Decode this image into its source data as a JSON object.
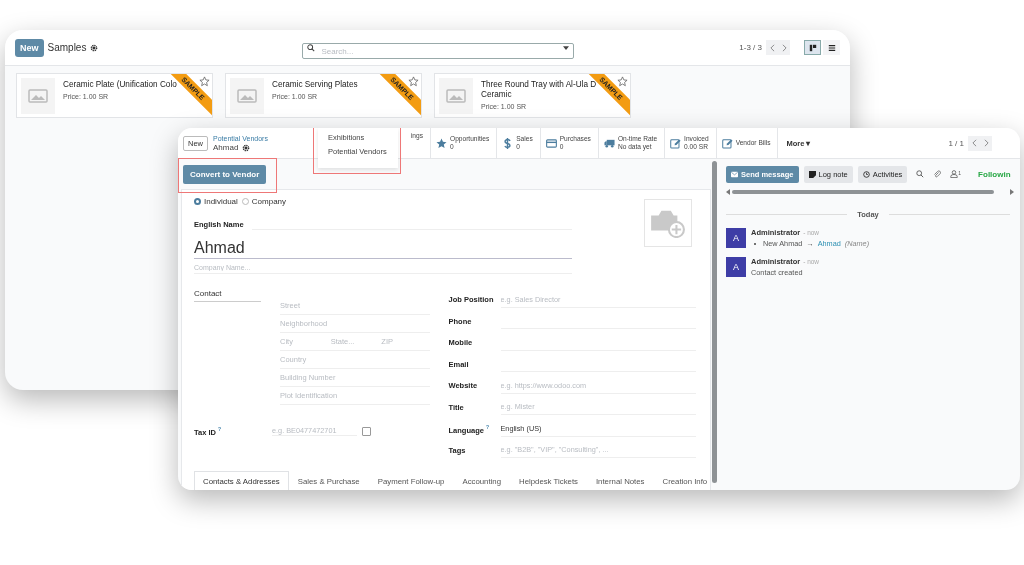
{
  "back_window": {
    "new_button": "New",
    "title": "Samples",
    "search": {
      "placeholder": "Search..."
    },
    "pager": "1-3 / 3",
    "views": [
      {
        "kind": "kanban",
        "selected": true
      },
      {
        "kind": "list",
        "selected": false
      }
    ],
    "cards": [
      {
        "name_lines": [
          "Ceramic Plate (Unification Colo"
        ],
        "price": "Price: 1.00 SR",
        "ribbon": "SAMPLE",
        "starred": false
      },
      {
        "name_lines": [
          "Ceramic Serving Plates"
        ],
        "price": "Price: 1.00 SR",
        "ribbon": "SAMPLE",
        "starred": false
      },
      {
        "name_lines": [
          "Three Round Tray with Al-Ula D",
          "Ceramic"
        ],
        "price": "Price: 1.00 SR",
        "ribbon": "SAMPLE",
        "starred": false
      }
    ]
  },
  "front_window": {
    "new_button": "New",
    "breadcrumb": "Potential Vendors",
    "record": "Ahmad",
    "dropdown": [
      "Exhibitions",
      "Potential Vendors"
    ],
    "stats": [
      {
        "kind": "none",
        "label": "ings"
      },
      {
        "kind": "star",
        "label": "Opportunities",
        "value": "0"
      },
      {
        "kind": "dollar",
        "label": "Sales",
        "value": "0"
      },
      {
        "kind": "card",
        "label": "Purchases",
        "value": "0"
      },
      {
        "kind": "truck",
        "label": "On-time Rate",
        "value": "No data yet"
      },
      {
        "kind": "edit",
        "label": "Invoiced",
        "value": "0.00 SR"
      },
      {
        "kind": "edit",
        "label": "Vendor Bills"
      }
    ],
    "more": "More ▾",
    "pager": "1 / 1",
    "action": "Convert to Vendor",
    "company_type": [
      {
        "label": "Individual",
        "selected": true
      },
      {
        "label": "Company",
        "selected": false
      }
    ],
    "name_label": "English Name",
    "name": "Ahmad",
    "company_placeholder": "Company Name...",
    "contact_label": "Contact",
    "address": [
      [
        {
          "placeholder": "Street"
        }
      ],
      [
        {
          "placeholder": "Neighborhood"
        }
      ],
      [
        {
          "placeholder": "City"
        },
        {
          "placeholder": "State..."
        },
        {
          "placeholder": "ZIP"
        }
      ],
      [
        {
          "placeholder": "Country"
        }
      ],
      [
        {
          "placeholder": "Building Number"
        }
      ],
      [
        {
          "placeholder": "Plot Identification"
        }
      ]
    ],
    "fields": [
      {
        "label": "Job Position",
        "placeholder": "e.g. Sales Director"
      },
      {
        "label": "Phone"
      },
      {
        "label": "Mobile"
      },
      {
        "label": "Email"
      },
      {
        "label": "Website",
        "placeholder": "e.g. https://www.odoo.com"
      },
      {
        "label": "Title",
        "placeholder": "e.g. Mister"
      }
    ],
    "tax": {
      "label": "Tax ID",
      "help": "?",
      "placeholder": "e.g. BE0477472701",
      "checked": false
    },
    "language": {
      "label": "Language",
      "help": "?",
      "value": "English (US)"
    },
    "tags": {
      "label": "Tags",
      "placeholder": "e.g. \"B2B\", \"VIP\", \"Consulting\", ..."
    },
    "tabs": [
      {
        "label": "Contacts & Addresses",
        "selected": true
      },
      {
        "label": "Sales & Purchase",
        "selected": false
      },
      {
        "label": "Payment Follow-up",
        "selected": false
      },
      {
        "label": "Accounting",
        "selected": false
      },
      {
        "label": "Helpdesk Tickets",
        "selected": false
      },
      {
        "label": "Internal Notes",
        "selected": false
      },
      {
        "label": "Creation Info",
        "selected": false
      }
    ],
    "chatter": {
      "send": "Send message",
      "log": "Log note",
      "activities": "Activities",
      "followers": "1",
      "follow": "Followin",
      "day": "Today",
      "messages": [
        {
          "avatar": "A",
          "author": "Administrator",
          "time": "- now",
          "kind": "change",
          "old": "New Ahmad",
          "arrow": "→",
          "new": "Ahmad",
          "field": "(Name)"
        },
        {
          "avatar": "A",
          "author": "Administrator",
          "time": "- now",
          "kind": "text",
          "body": "Contact created"
        }
      ]
    }
  }
}
